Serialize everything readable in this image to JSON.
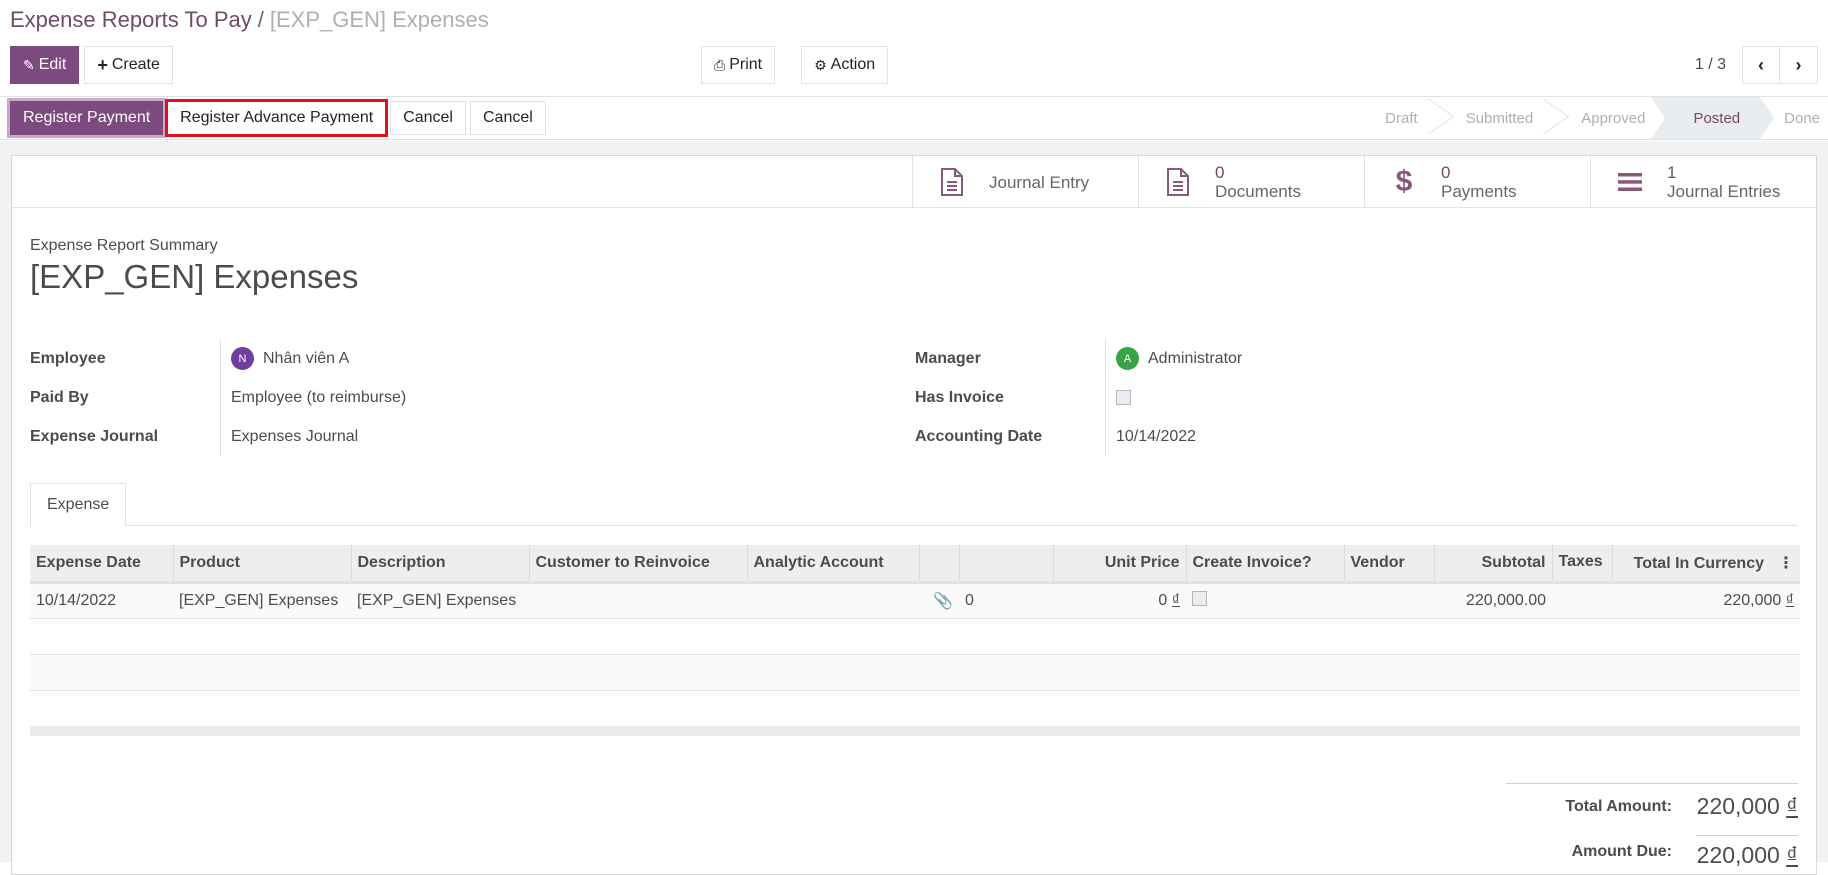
{
  "breadcrumb": {
    "parent": "Expense Reports To Pay",
    "separator": "/",
    "current": "[EXP_GEN] Expenses"
  },
  "toolbar": {
    "edit_label": "Edit",
    "create_label": "Create",
    "print_label": "Print",
    "action_label": "Action"
  },
  "pager": {
    "value": "1 / 3"
  },
  "statusbar": {
    "buttons": [
      "Register Payment",
      "Register Advance Payment",
      "Cancel",
      "Cancel"
    ],
    "stages": [
      "Draft",
      "Submitted",
      "Approved",
      "Posted",
      "Done"
    ],
    "current_stage": "Posted"
  },
  "smart_buttons": [
    {
      "icon": "file-text-icon",
      "count": "",
      "label": "Journal Entry"
    },
    {
      "icon": "file-text-icon",
      "count": "0",
      "label": "Documents"
    },
    {
      "icon": "dollar-icon",
      "count": "0",
      "label": "Payments"
    },
    {
      "icon": "bars-icon",
      "count": "1",
      "label": "Journal Entries"
    }
  ],
  "form": {
    "subtitle": "Expense Report Summary",
    "title": "[EXP_GEN] Expenses",
    "left": {
      "employee_label": "Employee",
      "employee_initial": "N",
      "employee_value": "Nhân viên A",
      "paid_by_label": "Paid By",
      "paid_by_value": "Employee (to reimburse)",
      "journal_label": "Expense Journal",
      "journal_value": "Expenses Journal"
    },
    "right": {
      "manager_label": "Manager",
      "manager_initial": "A",
      "manager_value": "Administrator",
      "has_invoice_label": "Has Invoice",
      "has_invoice_checked": false,
      "accounting_date_label": "Accounting Date",
      "accounting_date_value": "10/14/2022"
    },
    "avatar_colors": {
      "employee": "#6f3fa0",
      "manager": "#3aa346"
    }
  },
  "tabs": [
    {
      "label": "Expense",
      "active": true
    }
  ],
  "table": {
    "headers": [
      "Expense Date",
      "Product",
      "Description",
      "Customer to Reinvoice",
      "Analytic Account",
      "",
      "",
      "Unit Price",
      "Create Invoice?",
      "Vendor",
      "Subtotal",
      "Taxes",
      "Total In Currency"
    ],
    "rows": [
      {
        "expense_date": "10/14/2022",
        "product": "[EXP_GEN] Expenses",
        "description": "[EXP_GEN] Expenses",
        "customer": "",
        "analytic": "",
        "attachments": "0",
        "quantity": "",
        "unit_price": "0",
        "currency": "₫",
        "create_invoice": false,
        "vendor": "",
        "subtotal": "220,000.00",
        "taxes": "",
        "total_currency": "220,000"
      }
    ]
  },
  "totals": {
    "total_label": "Total Amount:",
    "total_value": "220,000",
    "currency": "₫",
    "due_label": "Amount Due:",
    "due_value": "220,000"
  },
  "colors": {
    "brand": "#714b67",
    "primary_button": "#7c4a7e",
    "highlight": "#e0111b"
  }
}
